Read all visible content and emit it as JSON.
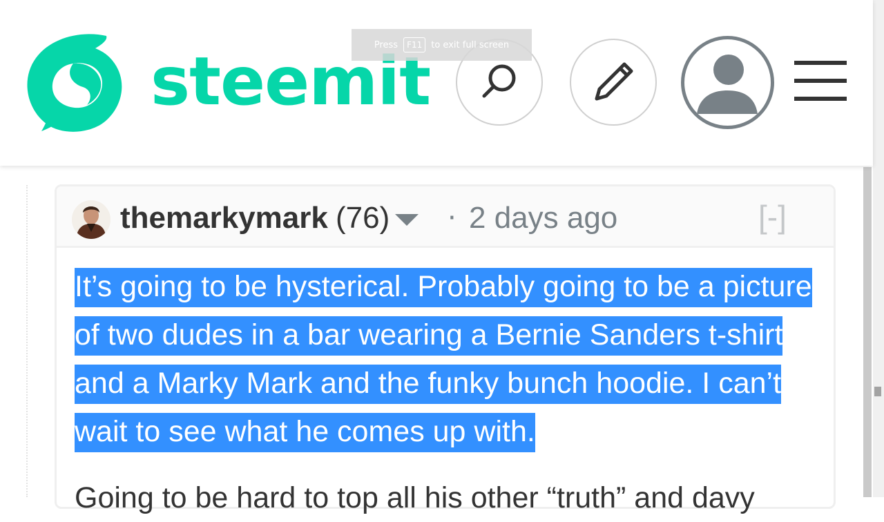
{
  "overlay": {
    "press": "Press",
    "key": "F11",
    "suffix": "to exit full screen"
  },
  "header": {
    "brand": "steemit",
    "colors": {
      "brand": "#06d6a9",
      "icons": "#333333",
      "avatar": "#788187"
    },
    "icons": [
      "steemit-logo-icon",
      "search-icon",
      "pencil-icon",
      "user-avatar-icon",
      "hamburger-menu-icon"
    ]
  },
  "comment": {
    "author": "themarkymark",
    "reputation": "(76)",
    "bullet": "·",
    "time": "2 days ago",
    "collapse": "[-]",
    "paragraph1": "It’s going to be hysterical. Probably going to be a picture of two dudes in a bar wearing a Bernie Sanders t-shirt and a Marky Mark and the funky bunch hoodie. I can’t wait to see what he comes up with.",
    "paragraph2": "Going to be hard to top all his other “truth” and davy",
    "highlight_color": "#3390ff"
  }
}
